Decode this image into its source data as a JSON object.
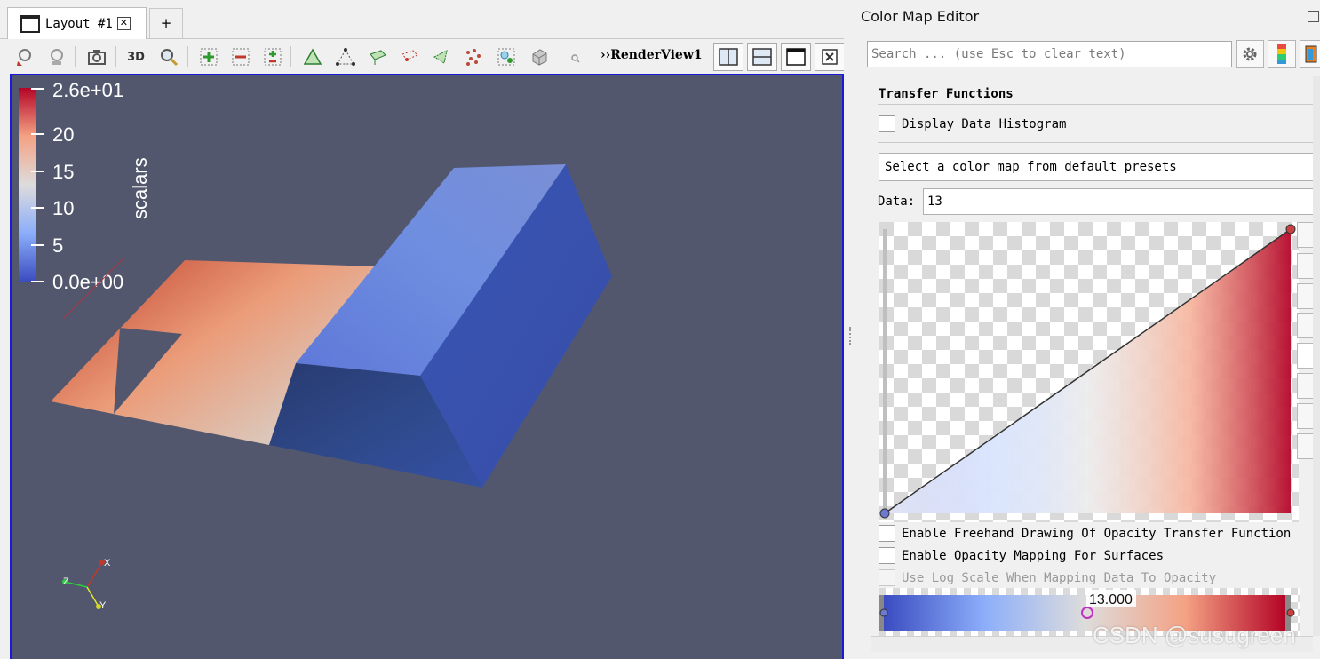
{
  "layout_tab": {
    "label": "Layout #1",
    "close_symbol": "✕",
    "add_label": "+"
  },
  "toolbar": {
    "three_d_label": "3D",
    "view_prefix": "››",
    "view_name": "RenderView1"
  },
  "render_view": {
    "background": "#52576e",
    "colorbar": {
      "title": "scalars",
      "ticks": [
        "2.6e+01",
        "20",
        "15",
        "10",
        "5",
        "0.0e+00"
      ]
    },
    "axes": {
      "x": "X",
      "y": "Y",
      "z": "Z"
    }
  },
  "color_map_editor": {
    "title": "Color Map Editor",
    "search_placeholder": "Search ... (use Esc to clear text)",
    "section_title": "Transfer Functions",
    "display_histogram_label": "Display Data Histogram",
    "preset_placeholder": "Select a color map from default presets",
    "data_label": "Data:",
    "data_value": "13",
    "freehand_label": "Enable Freehand Drawing Of Opacity Transfer Function",
    "opacity_surfaces_label": "Enable Opacity Mapping For Surfaces",
    "log_scale_label": "Use Log Scale When Mapping Data To Opacity",
    "ctf_value_label": "13.000"
  },
  "colors": {
    "cool": "#3b4cc0",
    "mid": "#dddcdc",
    "warm": "#b40426",
    "view_border": "#1a1adc"
  },
  "watermark": "CSDN @susugreen"
}
